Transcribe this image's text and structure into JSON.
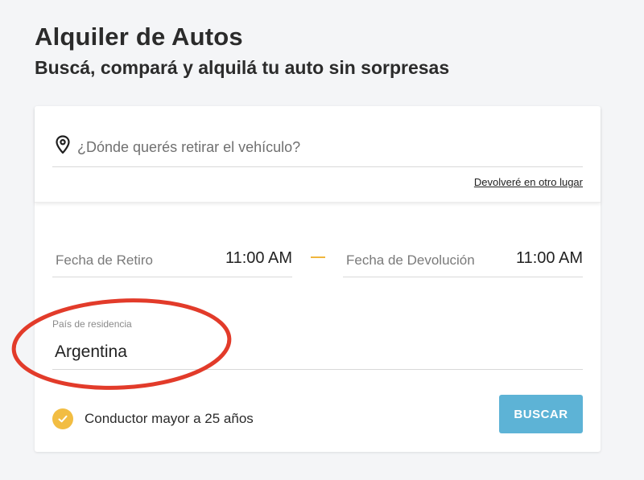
{
  "header": {
    "title": "Alquiler de Autos",
    "subtitle": "Buscá, compará y alquilá tu auto sin sorpresas"
  },
  "search_form": {
    "pickup_location": {
      "icon": "map-pin-icon",
      "value": "",
      "placeholder": "¿Dónde querés retirar el vehículo?"
    },
    "return_other_place_link": "Devolveré en otro lugar",
    "pickup_date": {
      "label": "Fecha de Retiro",
      "time": "11:00 AM"
    },
    "return_date": {
      "label": "Fecha de Devolución",
      "time": "11:00 AM"
    },
    "country": {
      "label": "País de residencia",
      "value": "Argentina"
    },
    "driver_age": {
      "icon": "check-icon",
      "checked": true,
      "label": "Conductor mayor a 25 años"
    },
    "search_button": "BUSCAR"
  },
  "colors": {
    "accent_button": "#5db3d6",
    "check_yellow": "#f2bd42",
    "separator_dash": "#f0b63d",
    "annotation_red": "#e23b2a",
    "background": "#f4f5f7"
  }
}
